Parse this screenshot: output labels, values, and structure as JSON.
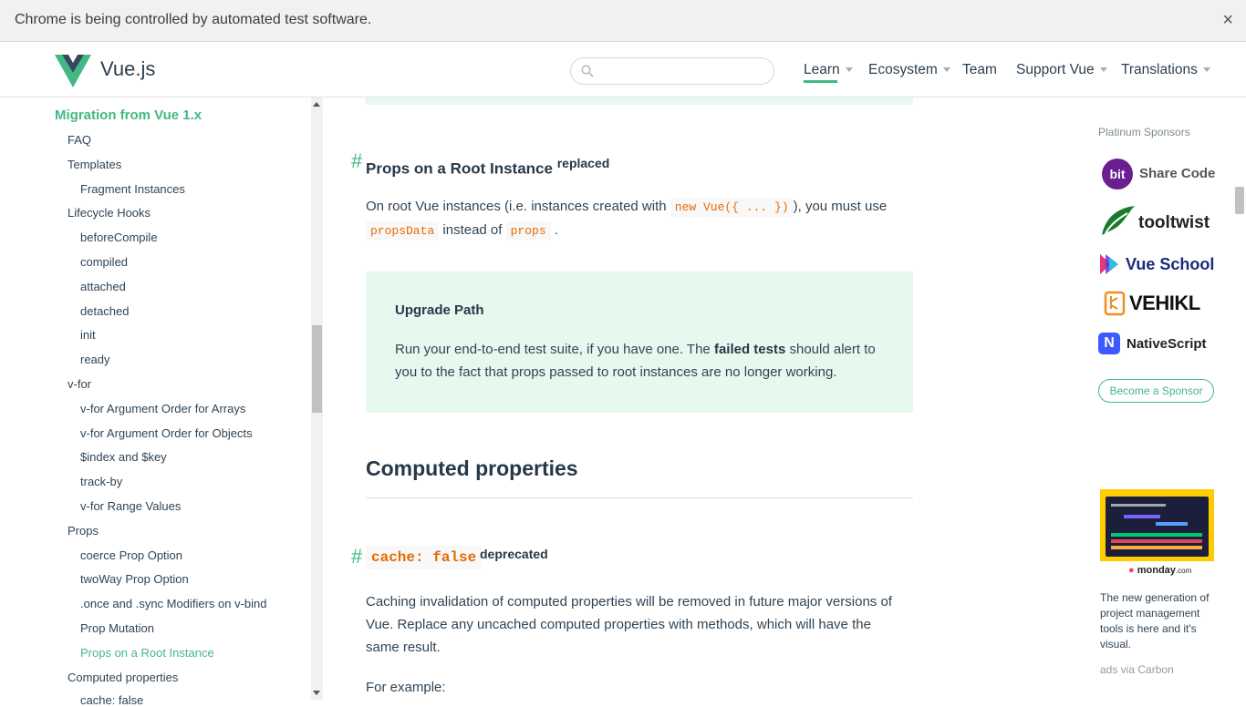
{
  "infobar": {
    "message": "Chrome is being controlled by automated test software.",
    "close": "×"
  },
  "header": {
    "logo_text": "Vue.js",
    "search_placeholder": "",
    "nav": [
      {
        "label": "Learn",
        "dropdown": true,
        "active": true
      },
      {
        "label": "Ecosystem",
        "dropdown": true
      },
      {
        "label": "Team",
        "dropdown": false
      },
      {
        "label": "Support Vue",
        "dropdown": true
      },
      {
        "label": "Translations",
        "dropdown": true
      }
    ]
  },
  "sidebar": {
    "section_title": "Migration from Vue 1.x",
    "items": [
      {
        "label": "FAQ",
        "level": 1
      },
      {
        "label": "Templates",
        "level": 1
      },
      {
        "label": "Fragment Instances",
        "level": 2
      },
      {
        "label": "Lifecycle Hooks",
        "level": 1
      },
      {
        "label": "beforeCompile",
        "level": 2
      },
      {
        "label": "compiled",
        "level": 2
      },
      {
        "label": "attached",
        "level": 2
      },
      {
        "label": "detached",
        "level": 2
      },
      {
        "label": "init",
        "level": 2
      },
      {
        "label": "ready",
        "level": 2
      },
      {
        "label": "v-for",
        "level": 1
      },
      {
        "label": "v-for Argument Order for Arrays",
        "level": 2
      },
      {
        "label": "v-for Argument Order for Objects",
        "level": 2
      },
      {
        "label": "$index and $key",
        "level": 2
      },
      {
        "label": "track-by",
        "level": 2
      },
      {
        "label": "v-for Range Values",
        "level": 2
      },
      {
        "label": "Props",
        "level": 1
      },
      {
        "label": "coerce Prop Option",
        "level": 2
      },
      {
        "label": "twoWay Prop Option",
        "level": 2
      },
      {
        "label": ".once and .sync Modifiers on v-bind",
        "level": 2
      },
      {
        "label": "Prop Mutation",
        "level": 2
      },
      {
        "label": "Props on a Root Instance",
        "level": 2,
        "active": true
      },
      {
        "label": "Computed properties",
        "level": 1
      },
      {
        "label": "cache: false",
        "level": 2
      }
    ]
  },
  "main": {
    "props_root": {
      "hash": "#",
      "title": "Props on a Root Instance",
      "badge": "replaced",
      "p_part1": "On root Vue instances (i.e. instances created with",
      "p_code1": "new Vue({ ... })",
      "p_part2": "), you must use",
      "p_code2": "propsData",
      "p_part3": "instead of",
      "p_code3": "props",
      "p_part4": "."
    },
    "upgrade": {
      "title": "Upgrade Path",
      "text1": "Run your end-to-end test suite, if you have one. The",
      "bold": "failed tests",
      "text2": "should alert to",
      "text3": "you to the fact that props passed to root instances are no longer working."
    },
    "computed": {
      "title": "Computed properties"
    },
    "cache": {
      "hash": "#",
      "code": "cache: false",
      "badge": "deprecated",
      "line1": "Caching invalidation of computed properties will be removed in future major versions of",
      "line2": "Vue. Replace any uncached computed properties with methods, which will have the",
      "line3": "same result.",
      "example": "For example:"
    }
  },
  "rail": {
    "platinum_label": "Platinum Sponsors",
    "sponsors": [
      {
        "name": "Share Code",
        "logo": "bit",
        "color": "#6b1e8f"
      },
      {
        "name": "tooltwist",
        "logo": "tooltwist-leaf",
        "color": "#1a7a2c"
      },
      {
        "name": "Vue School",
        "logo": "vueschool-mark",
        "color": "#1b2a7a"
      },
      {
        "name": "VEHIKL",
        "logo": "vehikl-mark",
        "color": "#f28c1f"
      },
      {
        "name": "NativeScript",
        "logo": "N",
        "color": "#3d5afe"
      }
    ],
    "become_sponsor": "Become a Sponsor",
    "ad_brand": "monday",
    "ad_brand_suffix": ".com",
    "ad_line1": "The new generation of",
    "ad_line2": "project management",
    "ad_line3": "tools is here and it's",
    "ad_line4": "visual.",
    "ads_via": "ads via Carbon"
  }
}
